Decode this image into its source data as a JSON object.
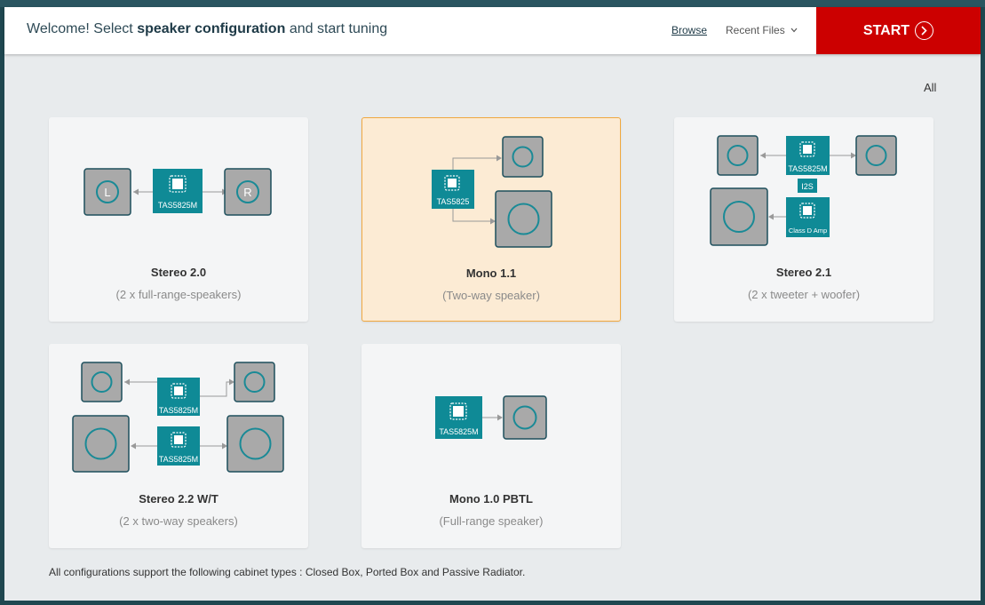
{
  "header": {
    "welcome_prefix": "Welcome! Select",
    "welcome_bold": "speaker configuration",
    "welcome_suffix": "and start tuning",
    "browse_label": "Browse",
    "recent_label": "Recent Files",
    "start_label": "START"
  },
  "filter": {
    "label": "All"
  },
  "cards": [
    {
      "title": "Stereo 2.0",
      "subtitle": "(2 x full-range-speakers)",
      "diagram": {
        "chip": "TAS5825M",
        "left_letter": "L",
        "right_letter": "R"
      },
      "selected": false
    },
    {
      "title": "Mono 1.1",
      "subtitle": "(Two-way speaker)",
      "diagram": {
        "chip": "TAS5825"
      },
      "selected": true
    },
    {
      "title": "Stereo 2.1",
      "subtitle": "(2 x tweeter + woofer)",
      "diagram": {
        "chip": "TAS5825M",
        "link": "I2S",
        "amp": "Class D Amp"
      },
      "selected": false
    },
    {
      "title": "Stereo 2.2 W/T",
      "subtitle": "(2 x two-way speakers)",
      "diagram": {
        "chip_top": "TAS5825M",
        "chip_bottom": "TAS5825M"
      },
      "selected": false
    },
    {
      "title": "Mono 1.0 PBTL",
      "subtitle": "(Full-range speaker)",
      "diagram": {
        "chip": "TAS5825M"
      },
      "selected": false
    }
  ],
  "footnote": "All configurations support the following cabinet types : Closed Box, Ported Box and Passive Radiator.",
  "colors": {
    "accent_teal": "#0f8a96",
    "start_red": "#cc0000",
    "selected_bg": "#fcebd4",
    "selected_border": "#f0a840"
  }
}
